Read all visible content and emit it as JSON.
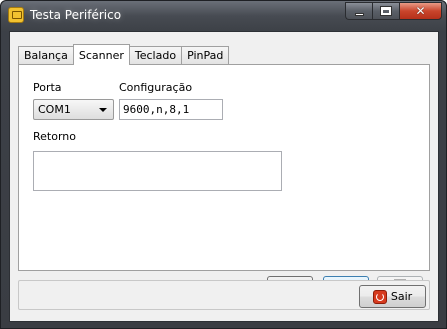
{
  "window": {
    "title": "Testa Periférico",
    "icon": "peripheral-app-icon",
    "buttons": {
      "minimize": "minimize-icon",
      "maximize": "maximize-icon",
      "close": "close-icon"
    }
  },
  "tabs": [
    {
      "label": "Balança",
      "active": false
    },
    {
      "label": "Scanner",
      "active": true
    },
    {
      "label": "Teclado",
      "active": false
    },
    {
      "label": "PinPad",
      "active": false
    }
  ],
  "scanner": {
    "porta_label": "Porta",
    "porta_value": "COM1",
    "config_label": "Configuração",
    "config_value": "9600,n,8,1",
    "retorno_label": "Retorno",
    "retorno_value": ""
  },
  "toolbar": {
    "save_icon": "floppy-disk-icon",
    "connect_icon": "plug-connect-icon",
    "delete_icon": "trash-icon"
  },
  "footer": {
    "sair_label": "Sair",
    "sair_icon": "power-icon"
  }
}
